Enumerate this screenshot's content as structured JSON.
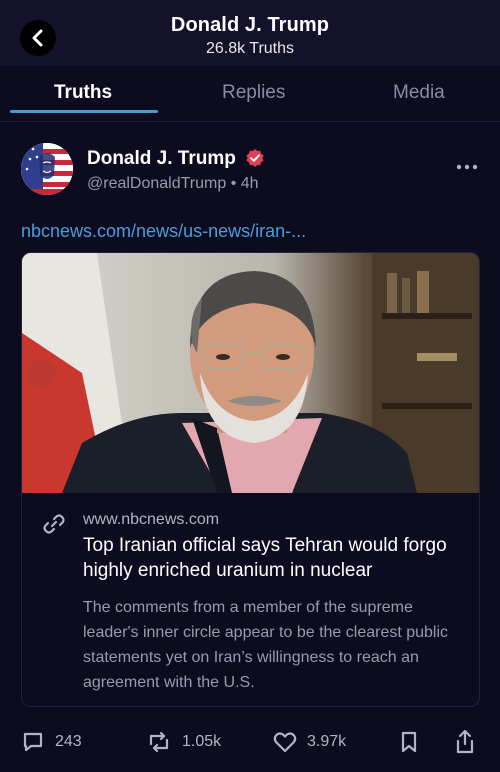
{
  "header": {
    "title": "Donald J. Trump",
    "subtitle": "26.8k Truths",
    "back_icon": "chevron-left-icon"
  },
  "tabs": [
    {
      "label": "Truths",
      "active": true
    },
    {
      "label": "Replies",
      "active": false
    },
    {
      "label": "Media",
      "active": false
    }
  ],
  "post": {
    "author_name": "Donald J. Trump",
    "handle": "@realDonaldTrump",
    "time_sep": "•",
    "time": "4h",
    "link_text": "nbcnews.com/news/us-news/iran-...",
    "card": {
      "domain": "www.nbcnews.com",
      "title": "Top Iranian official says Tehran would forgo highly enriched uranium in nuclear",
      "description": "The comments from a member of the supreme leader's inner circle appear to be the clearest public statements yet on Iran’s willingness to reach an agreement with the U.S."
    },
    "actions": {
      "replies": "243",
      "retruths": "1.05k",
      "likes": "3.97k"
    }
  },
  "colors": {
    "background": "#0d0b1f",
    "header_bg": "#14122a",
    "accent_link": "#4b9ed8",
    "tab_underline": "#4a9bd0",
    "verified": "#e03e52",
    "muted_text": "#9a99b0"
  }
}
